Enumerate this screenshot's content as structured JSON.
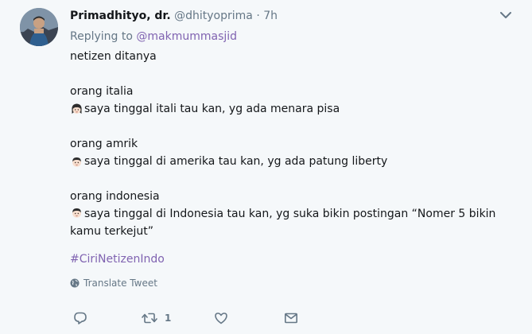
{
  "tweet": {
    "fullname": "Primadhityo, dr.",
    "username": "@dhityoprima",
    "separator": "·",
    "timestamp": "7h",
    "replying_prefix": "Replying to",
    "replying_to": "@makmummasjid",
    "lines": {
      "l1": "netizen ditanya",
      "l2": "orang italia",
      "l3": "saya tinggal itali tau kan, yg ada menara pisa",
      "l4": "orang amrik",
      "l5": "saya tinggal di amerika tau kan, yg ada patung liberty",
      "l6": "orang indonesia",
      "l7": "saya tinggal di Indonesia tau kan, yg suka bikin postingan “Nomer 5 bikin kamu terkejut”"
    },
    "emoji": {
      "l3": "woman-face-emoji",
      "l5": "man-face-emoji",
      "l7": "man-face-emoji"
    },
    "hashtag": "#CiriNetizenIndo",
    "translate_label": "Translate Tweet",
    "retweet_count": "1",
    "colors": {
      "link": "#8063b1",
      "muted": "#657786",
      "text": "#14171a",
      "background": "#f5f8fa"
    }
  }
}
